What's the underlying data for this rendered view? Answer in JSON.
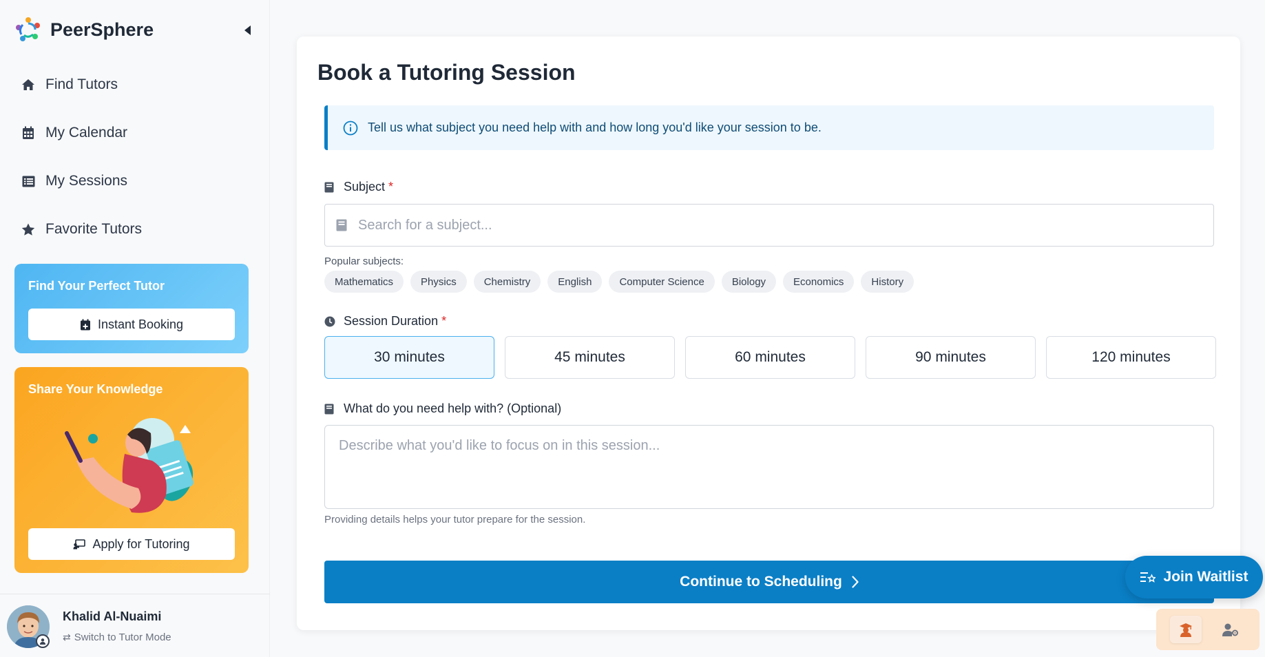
{
  "app": {
    "name": "PeerSphere"
  },
  "sidebar": {
    "nav": [
      {
        "label": "Find Tutors",
        "icon": "home-icon"
      },
      {
        "label": "My Calendar",
        "icon": "calendar-icon"
      },
      {
        "label": "My Sessions",
        "icon": "list-icon"
      },
      {
        "label": "Favorite Tutors",
        "icon": "star-icon"
      }
    ],
    "promo_tutor": {
      "title": "Find Your Perfect Tutor",
      "button": "Instant Booking"
    },
    "promo_share": {
      "title": "Share Your Knowledge",
      "button": "Apply for Tutoring"
    },
    "user": {
      "name": "Khalid Al-Nuaimi",
      "switch_label": "Switch to Tutor Mode"
    }
  },
  "main": {
    "title": "Book a Tutoring Session",
    "info": "Tell us what subject you need help with and how long you'd like your session to be.",
    "subject": {
      "label": "Subject",
      "required_mark": "*",
      "placeholder": "Search for a subject...",
      "popular_label": "Popular subjects:",
      "popular": [
        "Mathematics",
        "Physics",
        "Chemistry",
        "English",
        "Computer Science",
        "Biology",
        "Economics",
        "History"
      ]
    },
    "duration": {
      "label": "Session Duration",
      "required_mark": "*",
      "options": [
        "30 minutes",
        "45 minutes",
        "60 minutes",
        "90 minutes",
        "120 minutes"
      ],
      "selected": "30 minutes"
    },
    "help": {
      "label": "What do you need help with? (Optional)",
      "placeholder": "Describe what you'd like to focus on in this session...",
      "hint": "Providing details helps your tutor prepare for the session."
    },
    "continue_label": "Continue to Scheduling"
  },
  "floating": {
    "waitlist_label": "Join Waitlist"
  },
  "colors": {
    "primary": "#0a7fc6",
    "promo_blue": "#5bbdf5",
    "promo_orange": "#fcaf2e",
    "required": "#dc2626"
  }
}
